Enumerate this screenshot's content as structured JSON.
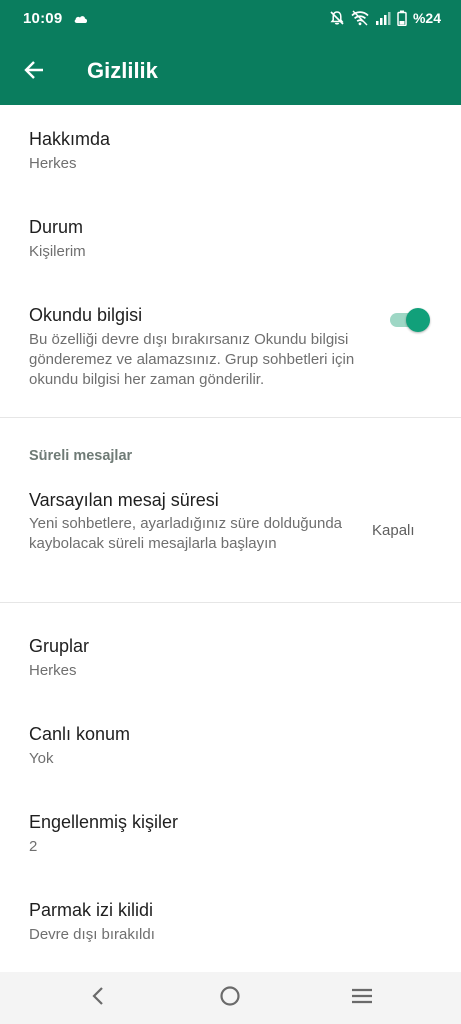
{
  "status_bar": {
    "time": "10:09",
    "battery_percent": "%24",
    "icons": [
      "cloud-icon",
      "notifications-off-icon",
      "wifi-icon",
      "signal-icon",
      "battery-icon"
    ]
  },
  "header": {
    "title": "Gizlilik",
    "back_icon": "arrow-left-icon",
    "background_color": "#0a7d5e"
  },
  "settings": {
    "about": {
      "title": "Hakkımda",
      "value": "Herkes"
    },
    "status": {
      "title": "Durum",
      "value": "Kişilerim"
    },
    "read_receipts": {
      "title": "Okundu bilgisi",
      "description": "Bu özelliği devre dışı bırakırsanız Okundu bilgisi gönderemez ve alamazsınız. Grup sohbetleri için okundu bilgisi her zaman gönderilir.",
      "enabled": true
    },
    "disappearing_section": {
      "header": "Süreli mesajlar",
      "default_timer": {
        "title": "Varsayılan mesaj süresi",
        "description": "Yeni sohbetlere, ayarladığınız süre dolduğunda kaybolacak süreli mesajlarla başlayın",
        "value": "Kapalı"
      }
    },
    "groups": {
      "title": "Gruplar",
      "value": "Herkes"
    },
    "live_location": {
      "title": "Canlı konum",
      "value": "Yok"
    },
    "blocked": {
      "title": "Engellenmiş kişiler",
      "value": "2"
    },
    "fingerprint": {
      "title": "Parmak izi kilidi",
      "value": "Devre dışı bırakıldı"
    }
  },
  "nav_bar": {
    "icons": [
      "back-nav-icon",
      "home-nav-icon",
      "menu-nav-icon"
    ]
  },
  "colors": {
    "accent": "#11a07a",
    "toggle_track": "#9ed7c5"
  }
}
